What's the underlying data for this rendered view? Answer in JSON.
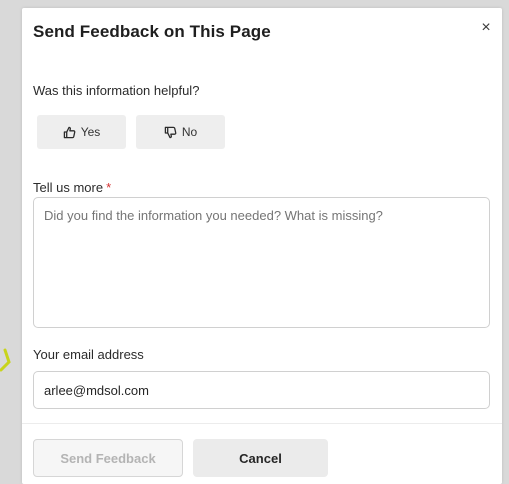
{
  "dialog": {
    "title": "Send Feedback on This Page",
    "close_symbol": "×"
  },
  "helpful": {
    "question": "Was this information helpful?",
    "yes_label": "Yes",
    "no_label": "No",
    "yes_icon": "thumbs-up-icon",
    "no_icon": "thumbs-down-icon"
  },
  "details": {
    "label": "Tell us more",
    "required_marker": "*",
    "placeholder": "Did you find the information you needed? What is missing?",
    "value": ""
  },
  "email": {
    "label": "Your email address",
    "value": "arlee@mdsol.com"
  },
  "actions": {
    "send_label": "Send Feedback",
    "cancel_label": "Cancel"
  },
  "colors": {
    "required": "#d32f2f",
    "accent_mark": "#c8d41c"
  }
}
